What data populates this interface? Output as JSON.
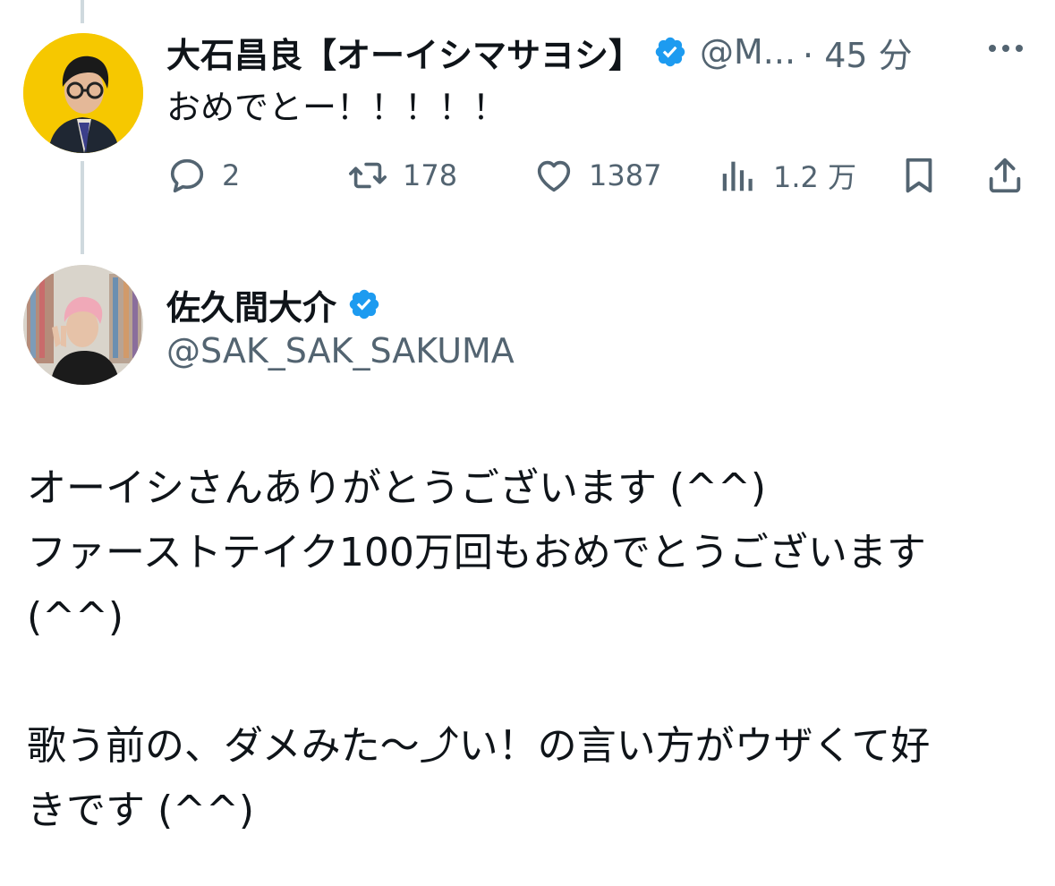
{
  "reply": {
    "display_name": "大石昌良【オーイシマサヨシ】",
    "handle": "@M...",
    "time": "· 45 分",
    "text": "おめでとー！！！！！",
    "actions": {
      "reply_count": "2",
      "retweet_count": "178",
      "like_count": "1387",
      "view_count": "1.2 万"
    },
    "verified_icon": "verified-badge-icon",
    "more_icon": "more-dots-icon"
  },
  "main_tweet": {
    "display_name": "佐久間大介",
    "handle": "@SAK_SAK_SAKUMA",
    "lines": [
      "オーイシさんありがとうございます (^^)",
      "ファーストテイク100万回もおめでとうございます",
      "(^^)",
      "",
      "歌う前の、ダメみた〜⤴︎い！の言い方がウザくて好",
      "きです (^^)"
    ]
  },
  "colors": {
    "verified_blue": "#1d9bf0",
    "secondary_text": "#536471",
    "primary_text": "#0f1419",
    "thread_line": "#cfd9de",
    "oishi_avatar_bg": "#f6c800"
  }
}
